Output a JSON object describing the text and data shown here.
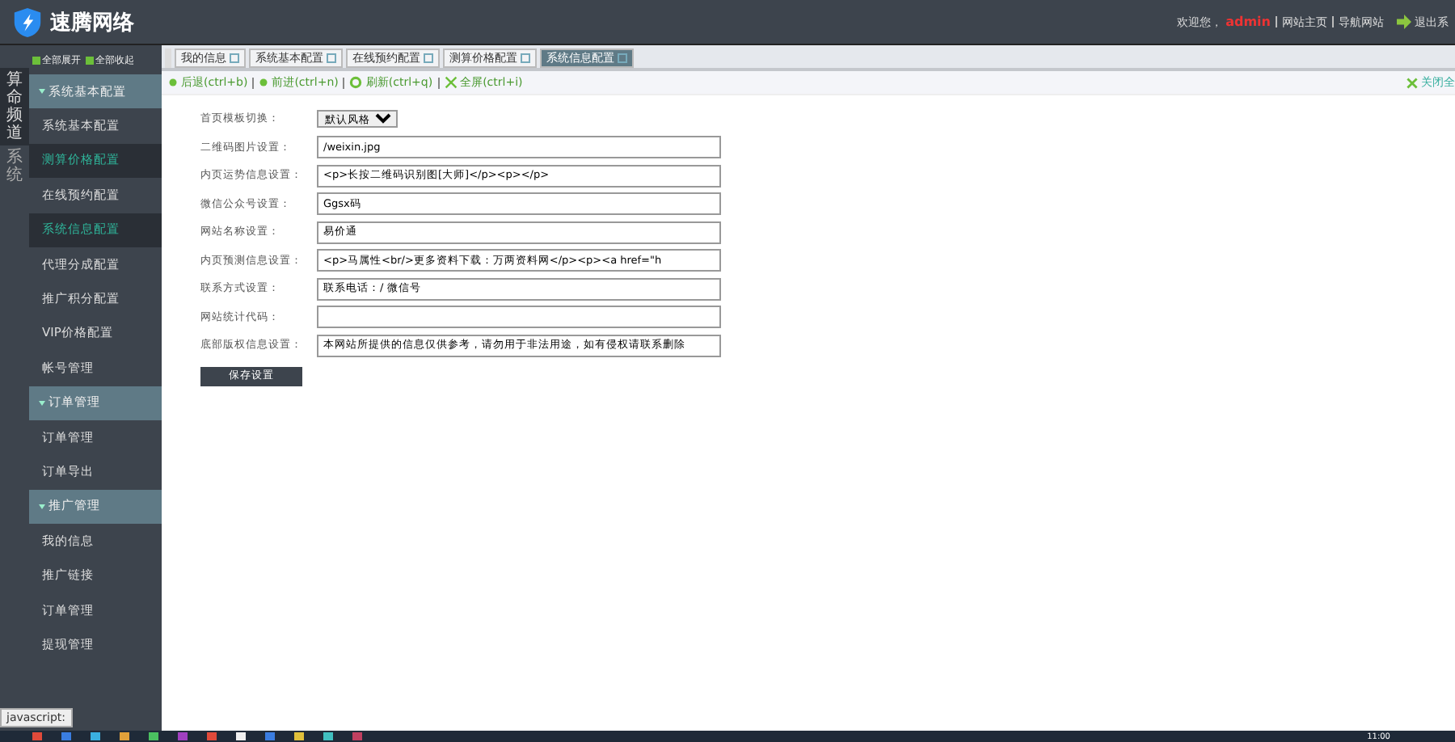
{
  "header": {
    "logo_text": "速腾网络",
    "welcome": "欢迎您，",
    "user": "admin",
    "links": [
      "网站主页",
      "导航网站"
    ],
    "logout": "退出系"
  },
  "side_tabs": [
    {
      "label": "算命频道",
      "selected": true
    },
    {
      "label": "系统",
      "selected": false
    }
  ],
  "sidebar_actions": [
    "全部展开",
    "全部收起"
  ],
  "sidebar": [
    {
      "label": "系统基本配置",
      "expanded": true,
      "children": [
        {
          "label": "系统基本配置",
          "selected": false
        },
        {
          "label": "测算价格配置",
          "selected": true
        },
        {
          "label": "在线预约配置",
          "selected": false
        },
        {
          "label": "系统信息配置",
          "selected": true
        },
        {
          "label": "代理分成配置",
          "selected": false
        },
        {
          "label": "推广积分配置",
          "selected": false
        },
        {
          "label": "VIP价格配置",
          "selected": false
        },
        {
          "label": "帐号管理",
          "selected": false
        }
      ]
    },
    {
      "label": "订单管理",
      "expanded": true,
      "children": [
        {
          "label": "订单管理",
          "selected": false
        },
        {
          "label": "订单导出",
          "selected": false
        }
      ]
    },
    {
      "label": "推广管理",
      "expanded": true,
      "children": [
        {
          "label": "我的信息",
          "selected": false
        },
        {
          "label": "推广链接",
          "selected": false
        },
        {
          "label": "订单管理",
          "selected": false
        },
        {
          "label": "提现管理",
          "selected": false
        }
      ]
    }
  ],
  "tabs": [
    {
      "label": "我的信息",
      "selected": false
    },
    {
      "label": "系统基本配置",
      "selected": false
    },
    {
      "label": "在线预约配置",
      "selected": false
    },
    {
      "label": "测算价格配置",
      "selected": false
    },
    {
      "label": "系统信息配置",
      "selected": true
    }
  ],
  "toolbar": [
    {
      "label": "后退(ctrl+b)",
      "kind": "back"
    },
    {
      "label": "前进(ctrl+n)",
      "kind": "forward"
    },
    {
      "label": "刷新(ctrl+q)",
      "kind": "refresh"
    },
    {
      "label": "全屏(ctrl+i)",
      "kind": "fullscreen"
    }
  ],
  "close_all": "关闭全",
  "form": [
    {
      "label": "首页模板切换：",
      "kind": "select",
      "value": "默认风格"
    },
    {
      "label": "二维码图片设置：",
      "kind": "text",
      "value": "/weixin.jpg"
    },
    {
      "label": "内页运势信息设置：",
      "kind": "text",
      "value": "<p>长按二维码识别图[大师]</p><p></p>"
    },
    {
      "label": "微信公众号设置：",
      "kind": "text",
      "value": "Ggsx码"
    },
    {
      "label": "网站名称设置：",
      "kind": "text",
      "value": "易价通"
    },
    {
      "label": "内页预测信息设置：",
      "kind": "text",
      "value": "<p>马属性<br/>更多资料下载：万两资料网</p><p><a href=\"h"
    },
    {
      "label": "联系方式设置：",
      "kind": "text",
      "value": "联系电话：/ 微信号"
    },
    {
      "label": "网站统计代码：",
      "kind": "text"
    },
    {
      "label": "底部版权信息设置：",
      "kind": "text",
      "value": "本网站所提供的信息仅供参考，请勿用于非法用途，如有侵权请联系删除"
    }
  ],
  "save_button": "保存设置",
  "status_text": "javascript:",
  "taskbar": {
    "clock": "11:00"
  }
}
